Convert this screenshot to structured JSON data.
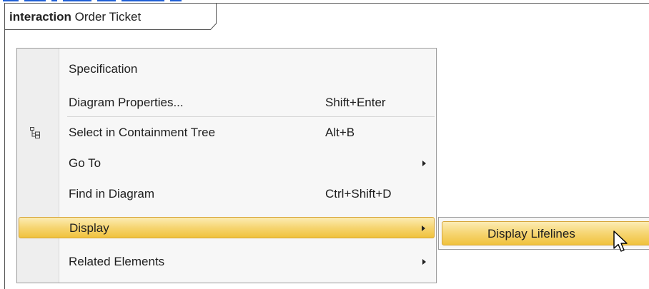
{
  "diagram": {
    "keyword": "interaction",
    "name": "Order Ticket"
  },
  "context_menu": {
    "items": [
      {
        "label": "Specification",
        "shortcut": "",
        "submenu": false
      },
      {
        "label": "Diagram Properties...",
        "shortcut": "Shift+Enter",
        "submenu": false
      },
      {
        "label": "Select in Containment Tree",
        "shortcut": "Alt+B",
        "submenu": false,
        "icon": "containment-tree-icon"
      },
      {
        "label": "Go To",
        "shortcut": "",
        "submenu": true
      },
      {
        "label": "Find in Diagram",
        "shortcut": "Ctrl+Shift+D",
        "submenu": false
      },
      {
        "label": "Display",
        "shortcut": "",
        "submenu": true,
        "highlighted": true
      },
      {
        "label": "Related Elements",
        "shortcut": "",
        "submenu": true
      }
    ]
  },
  "display_submenu": {
    "items": [
      {
        "label": "Display Lifelines",
        "highlighted": true
      }
    ]
  },
  "colors": {
    "highlight_top": "#fcecb4",
    "highlight_bottom": "#f0c23c",
    "highlight_border": "#d5a436",
    "menu_background": "#f7f7f7",
    "caption_blue": "#1f5fd6"
  },
  "cursor": "arrow-pointer-icon"
}
